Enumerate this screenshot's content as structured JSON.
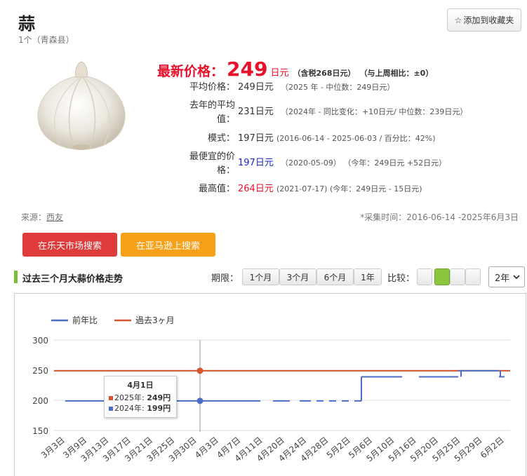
{
  "header": {
    "title": "蒜",
    "subtitle": "1个（青森县）",
    "favorite_icon": "☆",
    "favorite_label": "添加到收藏夹"
  },
  "product_image": {
    "icon": "garlic-image"
  },
  "price": {
    "latest_label": "最新价格：",
    "latest_value": "249",
    "latest_unit": "日元",
    "tax_note": "（含税268日元）",
    "week_compare": "（与上周相比：±0）",
    "rows": [
      {
        "label": "平均价格：",
        "value": "249日元",
        "detail": "（2025 年 - 中位数：249日元）"
      },
      {
        "label": "去年的平均值：",
        "value": "231日元",
        "detail_pre": "（2024年 - 同比变化：",
        "detail_red": "+10日元",
        "detail_post": "/ 中位数：239日元）"
      },
      {
        "label": "模式：",
        "value": "197日元",
        "detail": "(2016-06-14 - 2025-06-03 / 百分比：42%)"
      },
      {
        "label": "最便宜的价格：",
        "value": "197日元",
        "detail_pre": "（2020-05-09）  （今年：249日元 ",
        "detail_red": "+52日元",
        "detail_post": "）"
      },
      {
        "label": "最高值：",
        "value": "264日元",
        "detail_pre": "(2021-07-17) (今年：249日元 - ",
        "detail_blue": "15日元",
        "detail_post": ")"
      }
    ]
  },
  "source": {
    "label": "来源：",
    "link": "西友"
  },
  "crawl_period": "*采集时间：2016-06-14 -2025年6月3日",
  "actions": {
    "rakuten": "在乐天市场搜索",
    "amazon": "在亚马逊上搜索"
  },
  "section": {
    "title": "过去三个月大蒜价格走势",
    "period_label": "期限：",
    "periods": [
      "1个月",
      "3个月",
      "6个月",
      "1年"
    ],
    "compare_label": "比较：",
    "year_option": "2年",
    "colors": {
      "accent_green": "#7cbf3c",
      "red": "#e8102a",
      "blue": "#1a28c8"
    }
  },
  "chart_data": {
    "type": "line",
    "categories": [
      "3月3日",
      "3月9日",
      "3月13日",
      "3月17日",
      "3月21日",
      "3月25日",
      "3月30日",
      "4月3日",
      "4月7日",
      "4月11日",
      "4月20日",
      "4月24日",
      "4月28日",
      "5月2日",
      "5月6日",
      "5月10日",
      "5月16日",
      "5月20日",
      "5月25日",
      "5月29日",
      "6月2日"
    ],
    "series": [
      {
        "name": "前年比",
        "color": "#4a6ec8",
        "style": "dashed-gaps",
        "values": [
          199,
          199,
          199,
          199,
          199,
          199,
          199,
          199,
          199,
          199,
          199,
          199,
          199,
          199,
          239,
          239,
          239,
          239,
          239,
          249,
          239
        ]
      },
      {
        "name": "過去3ヶ月",
        "color": "#d9542b",
        "values": [
          249,
          249,
          249,
          249,
          249,
          249,
          249,
          249,
          249,
          249,
          249,
          249,
          249,
          249,
          249,
          249,
          249,
          249,
          249,
          249,
          249
        ]
      }
    ],
    "ylim": [
      150,
      300
    ],
    "yticks": [
      150,
      200,
      250,
      300
    ],
    "grid": true,
    "legend": "top-left",
    "tooltip": {
      "title": "4月1日",
      "row1_label": "2025年:",
      "row1_value": "249円",
      "row2_label": "2024年:",
      "row2_value": "199円"
    }
  }
}
